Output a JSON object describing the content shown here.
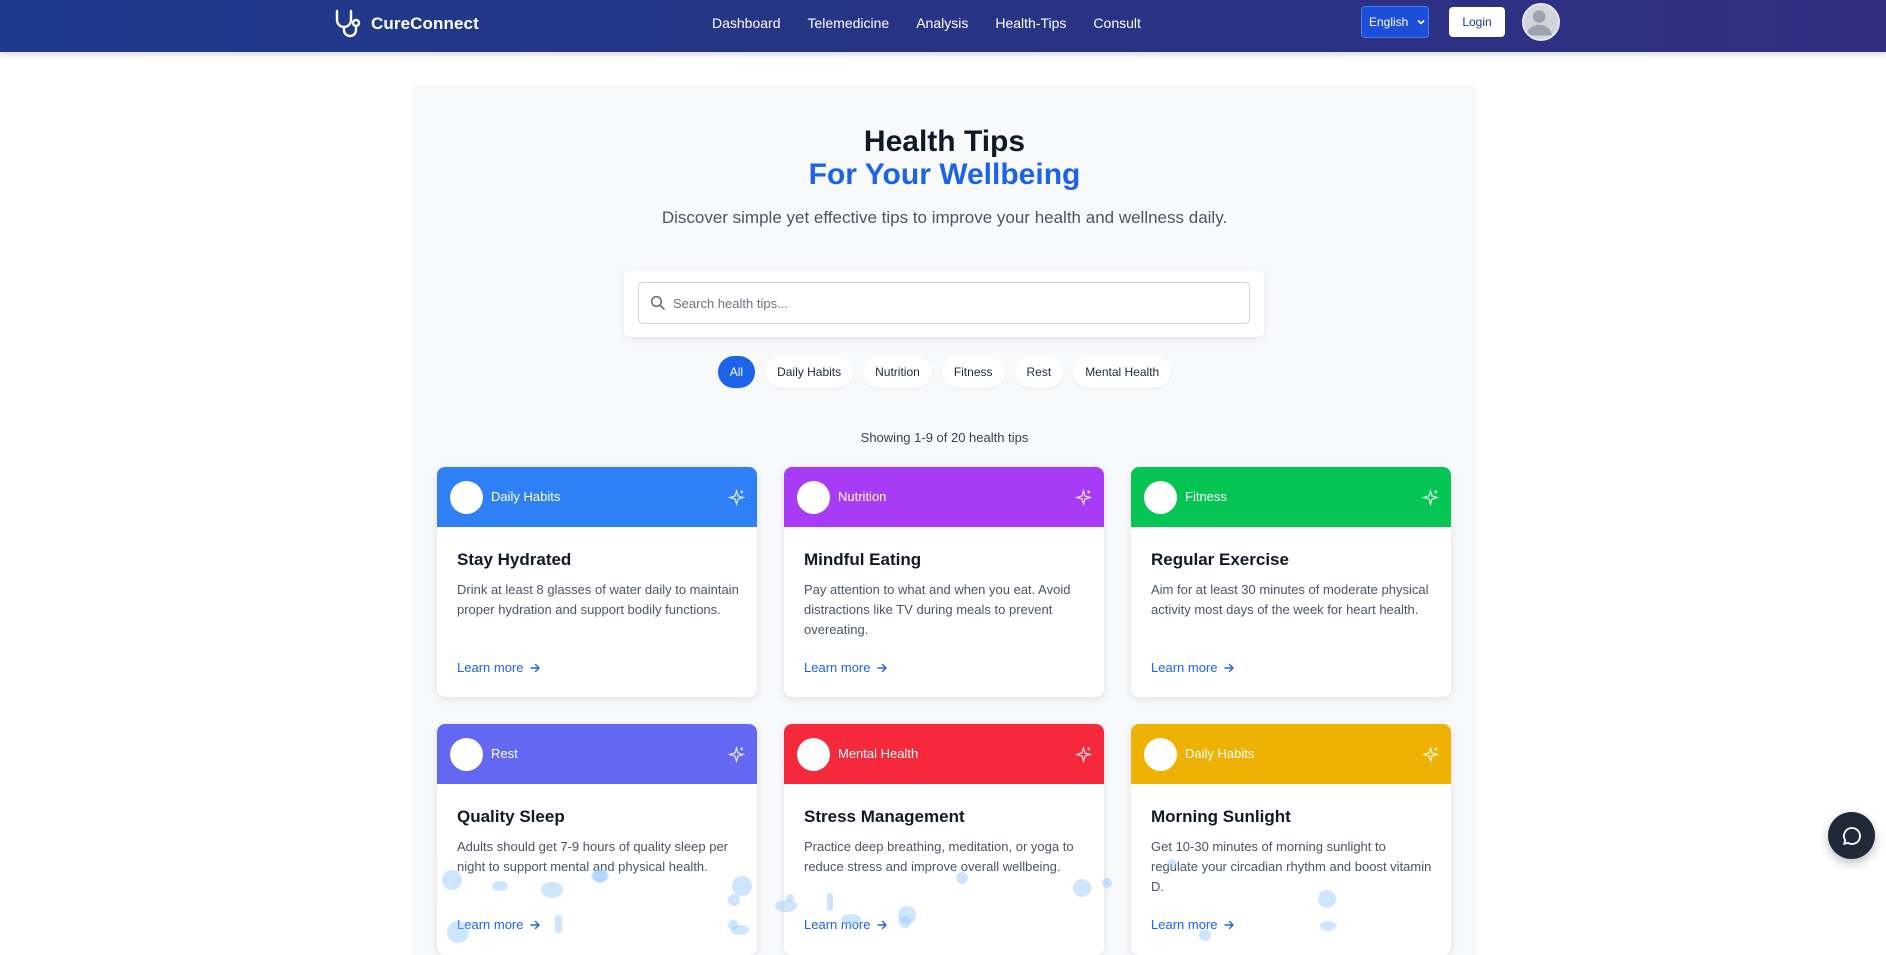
{
  "navbar": {
    "brand": "CureConnect",
    "links": [
      "Dashboard",
      "Telemedicine",
      "Analysis",
      "Health-Tips",
      "Consult"
    ],
    "language": "English",
    "login_label": "Login"
  },
  "hero": {
    "title": "Health Tips",
    "subtitle": "For Your Wellbeing",
    "description": "Discover simple yet effective tips to improve your health and wellness daily."
  },
  "search": {
    "placeholder": "Search health tips..."
  },
  "filters": [
    "All",
    "Daily Habits",
    "Nutrition",
    "Fitness",
    "Rest",
    "Mental Health"
  ],
  "showing": "Showing 1-9 of 20 health tips",
  "cards": [
    {
      "category": "Daily Habits",
      "color": "#2f80f7",
      "title": "Stay Hydrated",
      "description": "Drink at least 8 glasses of water daily to maintain proper hydration and support bodily functions.",
      "link": "Learn more"
    },
    {
      "category": "Nutrition",
      "color": "#a83cf6",
      "title": "Mindful Eating",
      "description": "Pay attention to what and when you eat. Avoid distractions like TV during meals to prevent overeating.",
      "link": "Learn more"
    },
    {
      "category": "Fitness",
      "color": "#06c653",
      "title": "Regular Exercise",
      "description": "Aim for at least 30 minutes of moderate physical activity most days of the week for heart health.",
      "link": "Learn more"
    },
    {
      "category": "Rest",
      "color": "#6467f2",
      "title": "Quality Sleep",
      "description": "Adults should get 7-9 hours of quality sleep per night to support mental and physical health.",
      "link": "Learn more"
    },
    {
      "category": "Mental Health",
      "color": "#f5293b",
      "title": "Stress Management",
      "description": "Practice deep breathing, meditation, or yoga to reduce stress and improve overall wellbeing.",
      "link": "Learn more"
    },
    {
      "category": "Daily Habits",
      "color": "#eeb204",
      "title": "Morning Sunlight",
      "description": "Get 10-30 minutes of morning sunlight to regulate your circadian rhythm and boost vitamin D.",
      "link": "Learn more"
    }
  ],
  "colors": {
    "nav_start": "#1e3a8a",
    "nav_end": "#312e81",
    "accent": "#1d63ea",
    "chat": "#1f2937"
  }
}
